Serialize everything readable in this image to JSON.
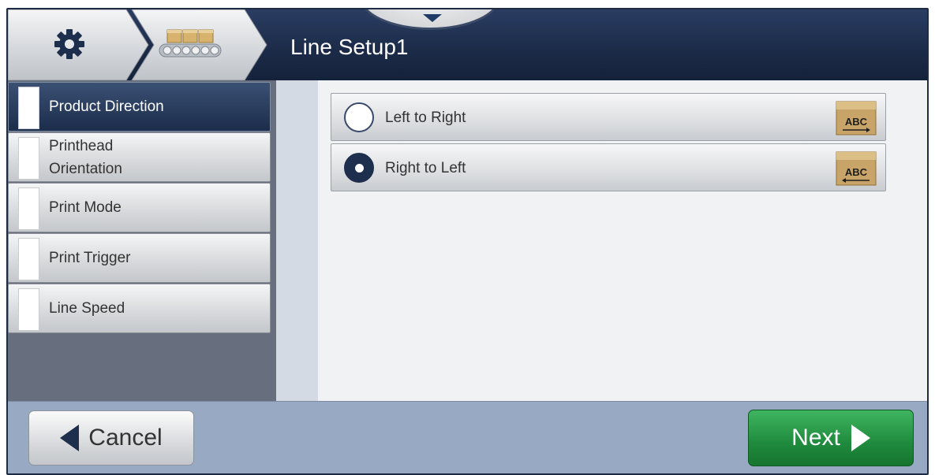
{
  "header": {
    "title": "Line Setup1",
    "breadcrumb": [
      {
        "icon": "gear-icon"
      },
      {
        "icon": "conveyor-icon"
      }
    ]
  },
  "sidebar": {
    "items": [
      {
        "label": "Product Direction",
        "active": true
      },
      {
        "label": "Printhead Orientation",
        "active": false
      },
      {
        "label": "Print Mode",
        "active": false
      },
      {
        "label": "Print Trigger",
        "active": false
      },
      {
        "label": "Line Speed",
        "active": false
      }
    ]
  },
  "main": {
    "options": [
      {
        "label": "Left to Right",
        "selected": false,
        "icon": "box-arrow-right-icon",
        "icon_text": "ABC"
      },
      {
        "label": "Right to Left",
        "selected": true,
        "icon": "box-arrow-left-icon",
        "icon_text": "ABC"
      }
    ]
  },
  "footer": {
    "cancel_label": "Cancel",
    "next_label": "Next"
  },
  "colors": {
    "header": "#1b2a47",
    "active_item": "#1c2d4b",
    "next_button": "#1f8a3d",
    "footer": "#97a9c3"
  }
}
